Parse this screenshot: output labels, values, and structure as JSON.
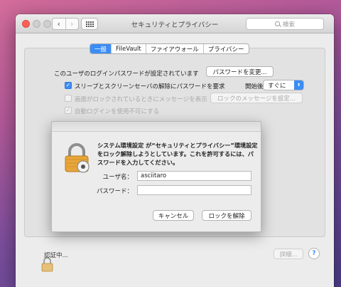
{
  "window": {
    "title": "セキュリティとプライバシー",
    "back_glyph": "‹",
    "forward_glyph": "›",
    "search_placeholder": "検索"
  },
  "tabs": [
    {
      "label": "一般",
      "active": true
    },
    {
      "label": "FileVault",
      "active": false
    },
    {
      "label": "ファイアウォール",
      "active": false
    },
    {
      "label": "プライバシー",
      "active": false
    }
  ],
  "general": {
    "password_set_text": "このユーザのログインパスワードが設定されています",
    "change_password_button": "パスワードを変更...",
    "require_password_label": "スリープとスクリーンセーバの解除にパスワードを要求",
    "require_password_checked": true,
    "start_after_label": "開始後：",
    "start_after_value": "すぐに",
    "show_message_label": "画面がロックされているときにメッセージを表示",
    "show_message_checked": false,
    "set_lock_message_button": "ロックのメッセージを設定...",
    "disable_autologin_label": "自動ログインを使用不可にする",
    "disable_autologin_checked": true
  },
  "dialog": {
    "message": "システム環境設定 が“セキュリティとプライバシー”環境設定をロック解除しようとしています。これを許可するには、パスワードを入力してください。",
    "username_label": "ユーザ名：",
    "username_value": "asciitaro",
    "password_label": "パスワード：",
    "password_value": "",
    "cancel_button": "キャンセル",
    "unlock_button": "ロックを解除"
  },
  "footer": {
    "status_text": "認証中...",
    "details_button": "詳細...",
    "help_glyph": "?"
  },
  "colors": {
    "accent": "#3b8df6",
    "close": "#fc5f57",
    "lock_gold": "#e7a63b"
  },
  "icons": [
    "close-icon",
    "minimize-icon",
    "zoom-icon",
    "back-icon",
    "forward-icon",
    "grid-icon",
    "search-icon",
    "lock-icon",
    "help-icon"
  ]
}
